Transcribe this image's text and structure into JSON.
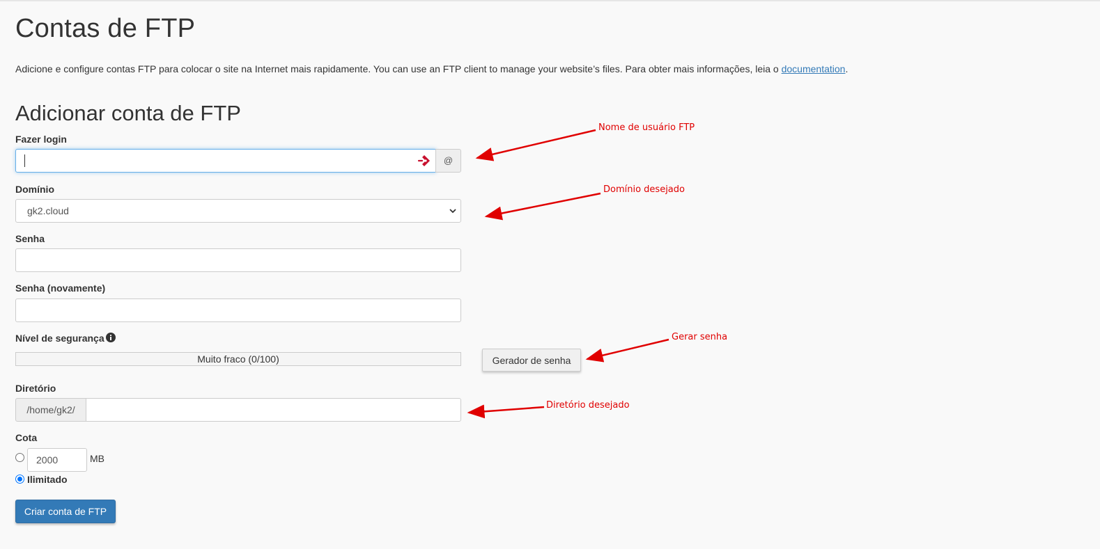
{
  "page": {
    "title": "Contas de FTP",
    "description_prefix": "Adicione e configure contas FTP para colocar o site na Internet mais rapidamente. You can use an FTP client to manage your website’s files. Para obter mais informações, leia o ",
    "description_link": "documentation",
    "description_suffix": "."
  },
  "form": {
    "section_title": "Adicionar conta de FTP",
    "login_label": "Fazer login",
    "login_value": "",
    "at_symbol": "@",
    "domain_label": "Domínio",
    "domain_selected": "gk2.cloud",
    "password_label": "Senha",
    "password_again_label": "Senha (novamente)",
    "strength_label": "Nível de segurança",
    "strength_text": "Muito fraco (0/100)",
    "strength_value": 0,
    "generator_button": "Gerador de senha",
    "directory_label": "Diretório",
    "directory_prefix": "/home/gk2/",
    "directory_value": "",
    "quota_label": "Cota",
    "quota_value": "2000",
    "quota_unit": "MB",
    "unlimited_label": "Ilimitado",
    "unlimited_selected": true,
    "submit_button": "Criar conta de FTP"
  },
  "annotations": {
    "username": "Nome de usuário FTP",
    "domain": "Domínio desejado",
    "generate": "Gerar senha",
    "directory": "Diretório desejado"
  },
  "colors": {
    "primary": "#337ab7",
    "annotation": "#e00000",
    "focus": "#66afe9"
  }
}
